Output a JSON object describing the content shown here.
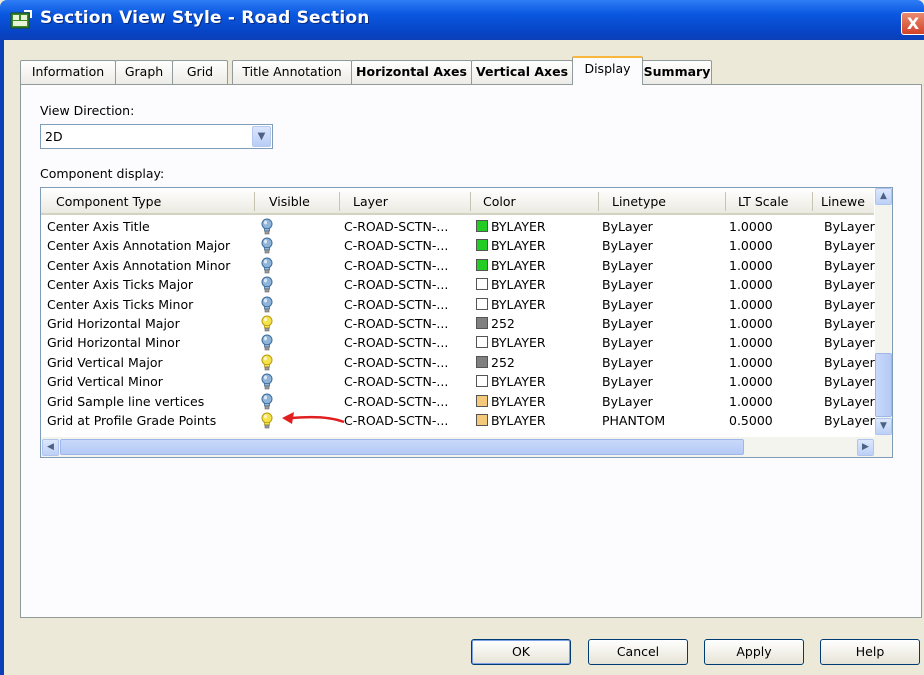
{
  "window": {
    "title": "Section View Style - Road Section",
    "close_label": "X"
  },
  "tabs": [
    {
      "label": "Information",
      "bold": false
    },
    {
      "label": "Graph",
      "bold": false
    },
    {
      "label": "Grid",
      "bold": false
    },
    {
      "label": "Title Annotation",
      "bold": false
    },
    {
      "label": "Horizontal Axes",
      "bold": true
    },
    {
      "label": "Vertical Axes",
      "bold": true
    },
    {
      "label": "Display",
      "bold": false,
      "active": true
    },
    {
      "label": "Summary",
      "bold": true
    }
  ],
  "view_direction": {
    "label": "View Direction:",
    "value": "2D"
  },
  "component_display": {
    "label": "Component display:"
  },
  "table": {
    "columns": [
      "Component Type",
      "Visible",
      "Layer",
      "Color",
      "Linetype",
      "LT Scale",
      "Linewe"
    ],
    "rows": [
      {
        "type": "Center Axis Title",
        "visible": "on",
        "layer": "C-ROAD-SCTN-...",
        "color": "BYLAYER",
        "color_hex": "#22cc22",
        "linetype": "ByLayer",
        "lt_scale": "1.0000",
        "lineweight": "ByLayer"
      },
      {
        "type": "Center Axis Annotation Major",
        "visible": "on",
        "layer": "C-ROAD-SCTN-...",
        "color": "BYLAYER",
        "color_hex": "#22cc22",
        "linetype": "ByLayer",
        "lt_scale": "1.0000",
        "lineweight": "ByLayer"
      },
      {
        "type": "Center Axis Annotation Minor",
        "visible": "on",
        "layer": "C-ROAD-SCTN-...",
        "color": "BYLAYER",
        "color_hex": "#22cc22",
        "linetype": "ByLayer",
        "lt_scale": "1.0000",
        "lineweight": "ByLayer"
      },
      {
        "type": "Center Axis Ticks Major",
        "visible": "on",
        "layer": "C-ROAD-SCTN-...",
        "color": "BYLAYER",
        "color_hex": "#ffffff",
        "linetype": "ByLayer",
        "lt_scale": "1.0000",
        "lineweight": "ByLayer"
      },
      {
        "type": "Center Axis Ticks Minor",
        "visible": "on",
        "layer": "C-ROAD-SCTN-...",
        "color": "BYLAYER",
        "color_hex": "#ffffff",
        "linetype": "ByLayer",
        "lt_scale": "1.0000",
        "lineweight": "ByLayer"
      },
      {
        "type": "Grid Horizontal Major",
        "visible": "off",
        "layer": "C-ROAD-SCTN-...",
        "color": "252",
        "color_hex": "#808080",
        "linetype": "ByLayer",
        "lt_scale": "1.0000",
        "lineweight": "ByLayer"
      },
      {
        "type": "Grid Horizontal Minor",
        "visible": "on",
        "layer": "C-ROAD-SCTN-...",
        "color": "BYLAYER",
        "color_hex": "#ffffff",
        "linetype": "ByLayer",
        "lt_scale": "1.0000",
        "lineweight": "ByLayer"
      },
      {
        "type": "Grid Vertical Major",
        "visible": "off",
        "layer": "C-ROAD-SCTN-...",
        "color": "252",
        "color_hex": "#808080",
        "linetype": "ByLayer",
        "lt_scale": "1.0000",
        "lineweight": "ByLayer"
      },
      {
        "type": "Grid Vertical Minor",
        "visible": "on",
        "layer": "C-ROAD-SCTN-...",
        "color": "BYLAYER",
        "color_hex": "#ffffff",
        "linetype": "ByLayer",
        "lt_scale": "1.0000",
        "lineweight": "ByLayer"
      },
      {
        "type": "Grid Sample line vertices",
        "visible": "on",
        "layer": "C-ROAD-SCTN-...",
        "color": "BYLAYER",
        "color_hex": "#f5c97a",
        "linetype": "ByLayer",
        "lt_scale": "1.0000",
        "lineweight": "ByLayer"
      },
      {
        "type": "Grid at Profile Grade Points",
        "visible": "off",
        "layer": "C-ROAD-SCTN-...",
        "color": "BYLAYER",
        "color_hex": "#f5c97a",
        "linetype": "PHANTOM",
        "lt_scale": "0.5000",
        "lineweight": "ByLayer"
      }
    ]
  },
  "buttons": {
    "ok": "OK",
    "cancel": "Cancel",
    "apply": "Apply",
    "help": "Help"
  },
  "colors": {
    "titlebar": "#0a58e0",
    "dialog_bg": "#ece9d8",
    "active_tab_accent": "#f8b73c",
    "annotation_arrow": "#e02020",
    "bulb_on": "#8fb4da",
    "bulb_off": "#f4e34a"
  }
}
